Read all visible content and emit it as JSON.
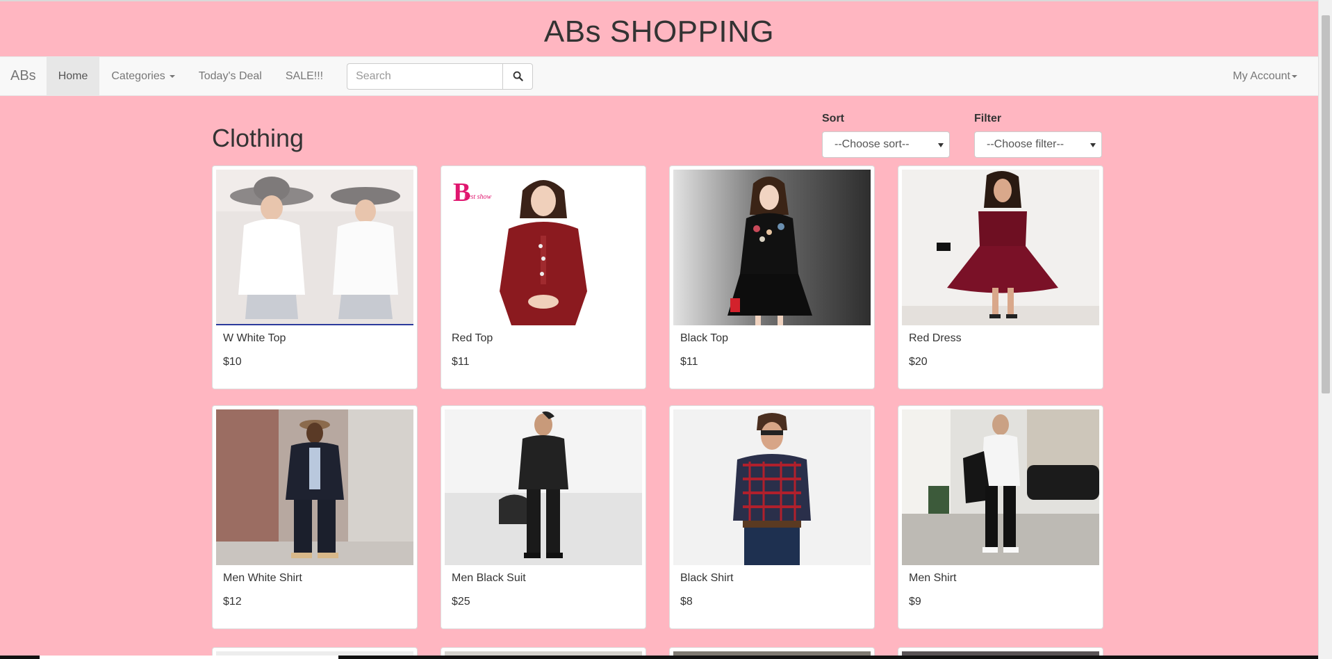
{
  "banner": {
    "title": "ABs SHOPPING"
  },
  "navbar": {
    "brand": "ABs",
    "items": [
      {
        "label": "Home"
      },
      {
        "label": "Categories"
      },
      {
        "label": "Today's Deal"
      },
      {
        "label": "SALE!!!"
      }
    ],
    "active_item": "Home",
    "search": {
      "placeholder": "Search",
      "value": "",
      "icon": "search-icon"
    },
    "account_label": "My Account"
  },
  "main": {
    "title": "Clothing",
    "sort": {
      "label": "Sort",
      "value": "--Choose sort--"
    },
    "filter": {
      "label": "Filter",
      "value": "--Choose filter--"
    },
    "products": [
      {
        "name": "W White Top",
        "price": "$10"
      },
      {
        "name": "Red Top",
        "price": "$11"
      },
      {
        "name": "Black Top",
        "price": "$11"
      },
      {
        "name": "Red Dress",
        "price": "$20"
      },
      {
        "name": "Men White Shirt",
        "price": "$12"
      },
      {
        "name": "Men Black Suit",
        "price": "$25"
      },
      {
        "name": "Black Shirt",
        "price": "$8"
      },
      {
        "name": "Men Shirt",
        "price": "$9"
      }
    ],
    "product_image_logo_text": "best show"
  },
  "colors": {
    "page_bg": "#ffb6c1",
    "navbar_bg": "#f8f8f8",
    "card_bg": "#ffffff"
  }
}
